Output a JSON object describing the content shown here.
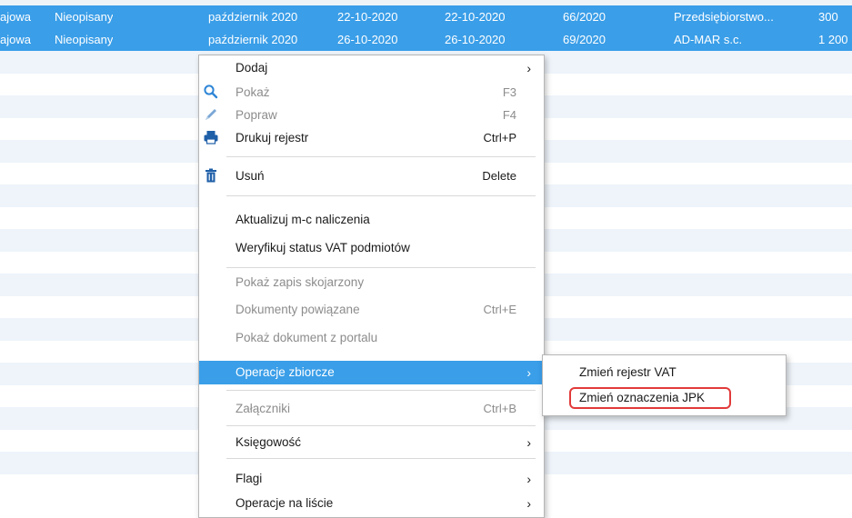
{
  "rows": [
    {
      "c1": "ajowa",
      "c2": "Nieopisany",
      "c3": "październik 2020",
      "c4": "22-10-2020",
      "c5": "22-10-2020",
      "c6": "66/2020",
      "c7": "Przedsiębiorstwo...",
      "c8": "300"
    },
    {
      "c1": "ajowa",
      "c2": "Nieopisany",
      "c3": "październik 2020",
      "c4": "26-10-2020",
      "c5": "26-10-2020",
      "c6": "69/2020",
      "c7": "AD-MAR s.c.",
      "c8": "1 200"
    }
  ],
  "menu": {
    "dodaj": {
      "label": "Dodaj",
      "arrow": "›"
    },
    "pokaz": {
      "label": "Pokaż",
      "shortcut": "F3"
    },
    "popraw": {
      "label": "Popraw",
      "shortcut": "F4"
    },
    "drukuj": {
      "label": "Drukuj rejestr",
      "shortcut": "Ctrl+P"
    },
    "usun": {
      "label": "Usuń",
      "shortcut": "Delete"
    },
    "aktualizuj": {
      "label": "Aktualizuj m-c naliczenia"
    },
    "weryfikuj": {
      "label": "Weryfikuj status VAT podmiotów"
    },
    "pokaz_zapis": {
      "label": "Pokaż zapis skojarzony"
    },
    "dokumenty": {
      "label": "Dokumenty powiązane",
      "shortcut": "Ctrl+E"
    },
    "pokaz_dok": {
      "label": "Pokaż dokument z portalu"
    },
    "operacje_zb": {
      "label": "Operacje zbiorcze",
      "arrow": "›"
    },
    "zalaczniki": {
      "label": "Załączniki",
      "shortcut": "Ctrl+B"
    },
    "ksiegowosc": {
      "label": "Księgowość",
      "arrow": "›"
    },
    "flagi": {
      "label": "Flagi",
      "arrow": "›"
    },
    "operacje_lista": {
      "label": "Operacje na liście",
      "arrow": "›"
    }
  },
  "submenu": {
    "zmien_rejestr": "Zmień rejestr VAT",
    "zmien_jpk": "Zmień oznaczenia JPK"
  },
  "icons": {
    "search": "search-icon",
    "pencil": "pencil-icon",
    "printer": "printer-icon",
    "trash": "trash-icon"
  },
  "colors": {
    "selection": "#3a9ee8",
    "icon_blue": "#1f5fa8",
    "highlight_box": "#e23a3a"
  }
}
